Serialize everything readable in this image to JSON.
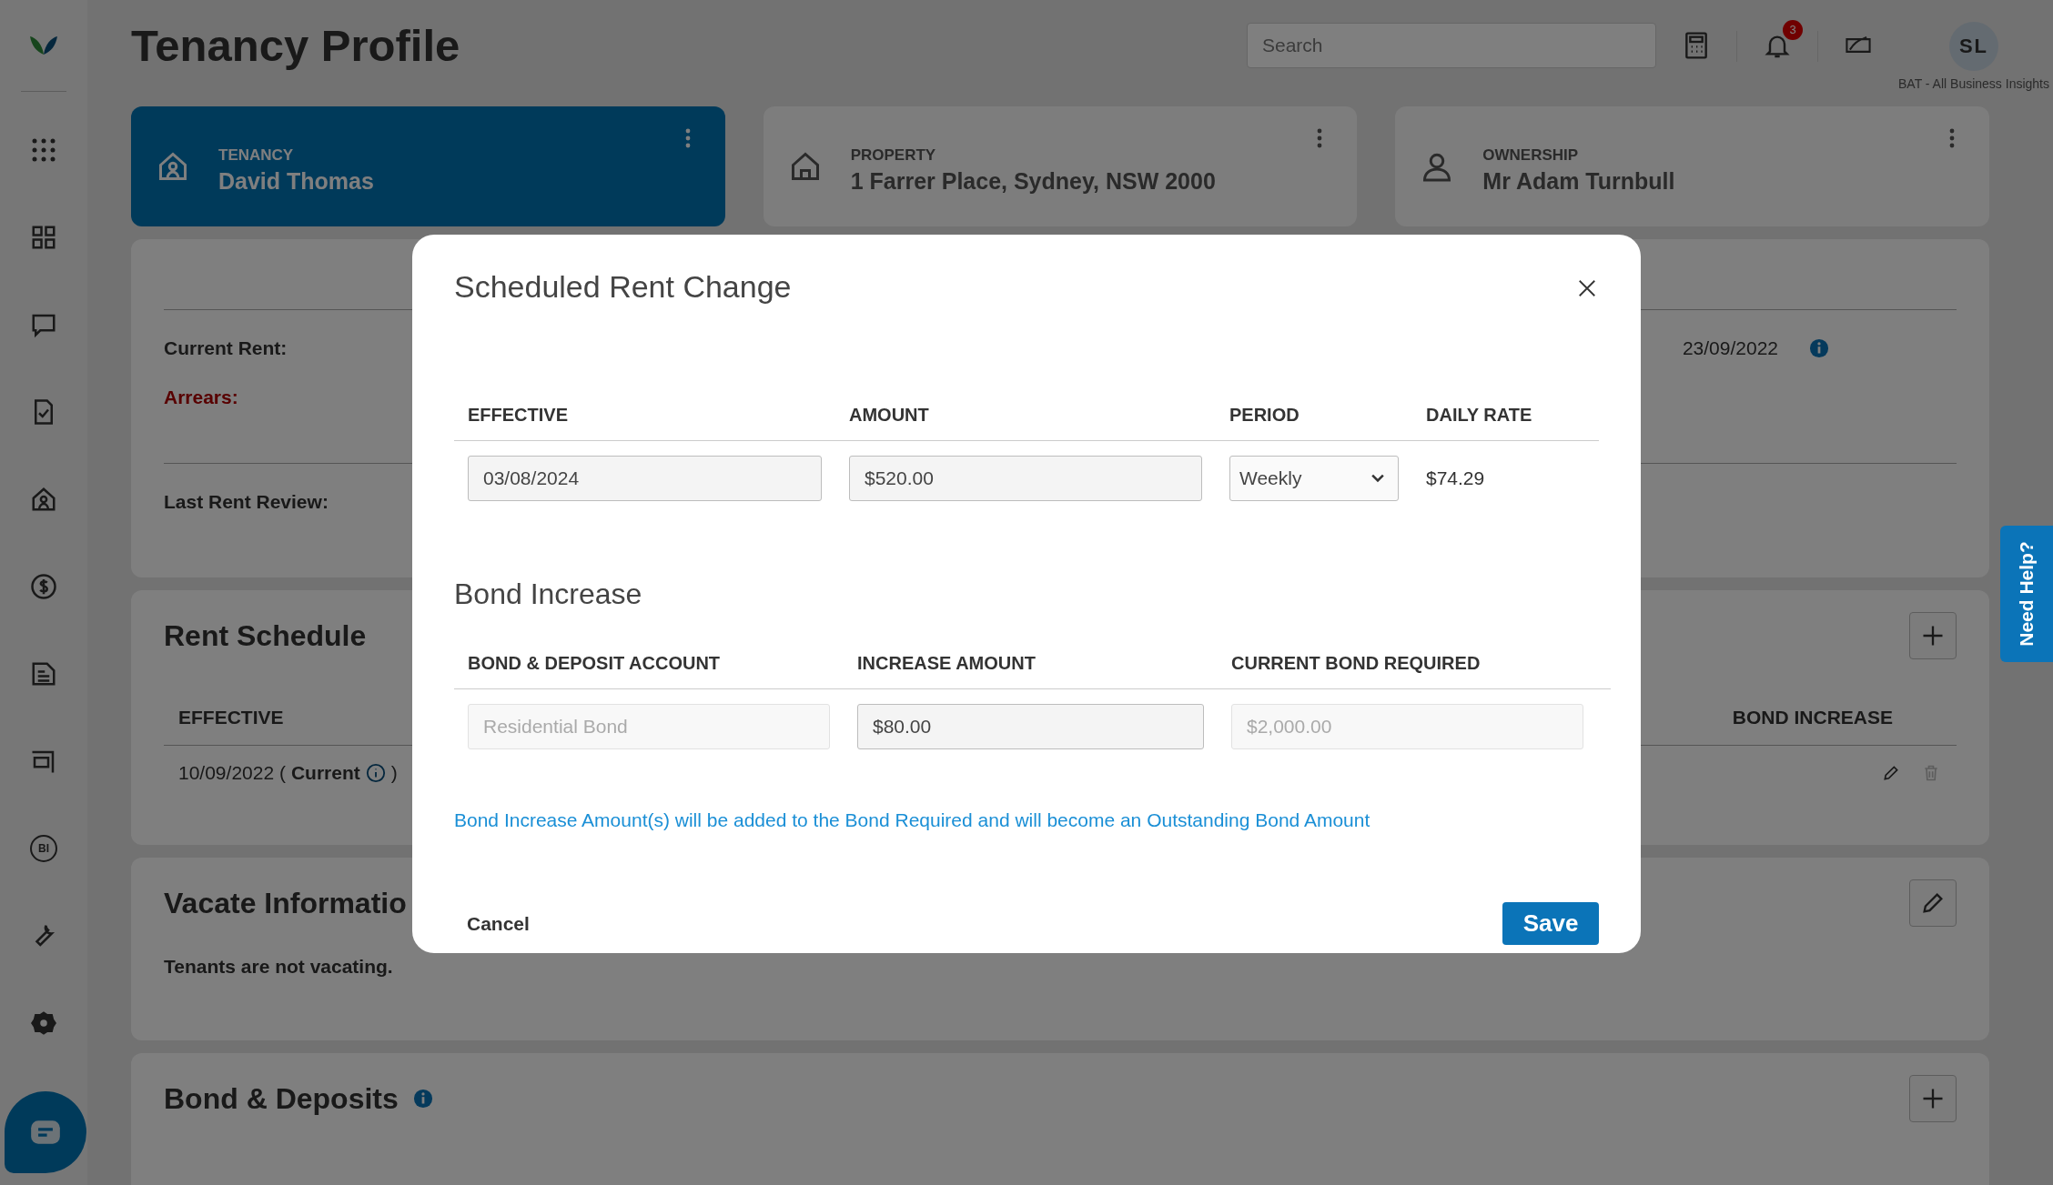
{
  "sidebar": {
    "bi_label": "BI"
  },
  "header": {
    "title": "Tenancy Profile",
    "search": {
      "placeholder": "Search"
    },
    "notifications": "3",
    "avatar": "SL",
    "org": "BAT - All Business Insights"
  },
  "context_cards": [
    {
      "kind": "tenancy",
      "label": "TENANCY",
      "value": "David Thomas",
      "selected": true
    },
    {
      "kind": "property",
      "label": "PROPERTY",
      "value": "1 Farrer Place, Sydney, NSW 2000",
      "selected": false
    },
    {
      "kind": "ownership",
      "label": "OWNERSHIP",
      "value": "Mr Adam Turnbull",
      "selected": false
    }
  ],
  "rent_summary": {
    "fields": [
      {
        "label": "Current Rent:",
        "kind": "normal"
      },
      {
        "label": "Arrears:",
        "kind": "alert"
      },
      {
        "label": "Last Rent Review:",
        "kind": "normal"
      }
    ],
    "date": "23/09/2022"
  },
  "rent_schedule": {
    "title": "Rent Schedule",
    "columns": [
      "EFFECTIVE",
      "BOND INCREASE"
    ],
    "rows": [
      {
        "date": "10/09/2022 (",
        "status": "Current",
        "close": ")",
        "delete_disabled": true
      }
    ]
  },
  "vacate": {
    "title": "Vacate Informatio",
    "text": "Tenants are not vacating."
  },
  "bond_deposits": {
    "title": "Bond & Deposits"
  },
  "help_tab": "Need Help?",
  "modal": {
    "title": "Scheduled Rent Change",
    "rent_columns": [
      {
        "heading": "EFFECTIVE",
        "kind": "input",
        "value": "03/08/2024",
        "disabled": false
      },
      {
        "heading": "AMOUNT",
        "kind": "input",
        "value": "$520.00",
        "disabled": false
      },
      {
        "heading": "PERIOD",
        "kind": "select",
        "value": "Weekly",
        "disabled": false
      },
      {
        "heading": "DAILY RATE",
        "kind": "text",
        "value": "$74.29"
      }
    ],
    "bond_title": "Bond Increase",
    "bond_columns": [
      {
        "heading": "BOND & DEPOSIT ACCOUNT",
        "kind": "input",
        "value": "Residential Bond",
        "disabled": true
      },
      {
        "heading": "INCREASE AMOUNT",
        "kind": "input",
        "value": "$80.00",
        "disabled": false
      },
      {
        "heading": "CURRENT BOND REQUIRED",
        "kind": "input",
        "value": "$2,000.00",
        "disabled": true
      }
    ],
    "note": "Bond Increase Amount(s) will be added to the Bond Required and will become an Outstanding Bond Amount",
    "cancel": "Cancel",
    "save": "Save"
  }
}
